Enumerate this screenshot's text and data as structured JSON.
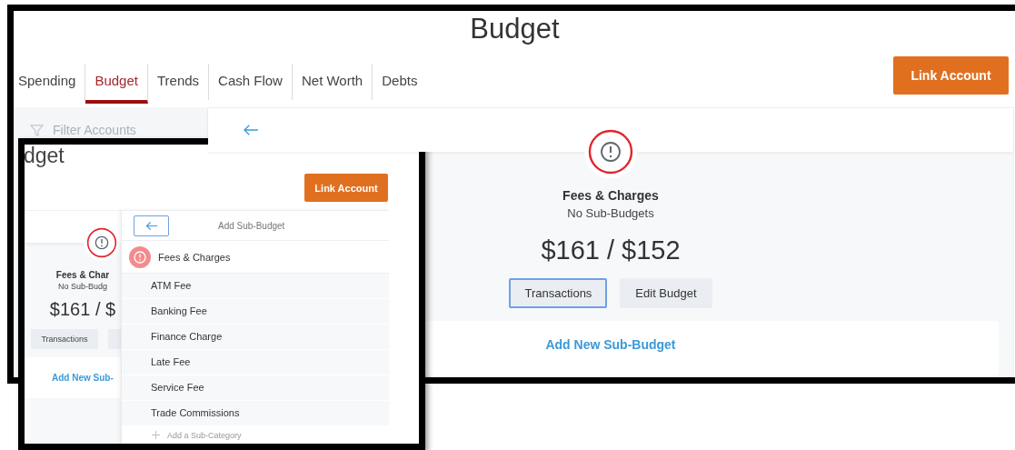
{
  "back_screenshot": {
    "page_title": "Budget",
    "tabs": [
      {
        "label": "Spending",
        "selected": false
      },
      {
        "label": "Budget",
        "selected": true
      },
      {
        "label": "Trends",
        "selected": false
      },
      {
        "label": "Cash Flow",
        "selected": false
      },
      {
        "label": "Net Worth",
        "selected": false
      },
      {
        "label": "Debts",
        "selected": false
      }
    ],
    "link_account_button": "Link Account",
    "filter_field": {
      "placeholder": "Filter Accounts"
    },
    "category": {
      "name": "Fees & Charges",
      "subtitle": "No Sub-Budgets",
      "amount": "$161 / $152"
    },
    "actions": [
      {
        "label": "Transactions",
        "selected": true
      },
      {
        "label": "Edit Budget",
        "selected": false
      }
    ],
    "add_link": "Add New Sub-Budget"
  },
  "front_screenshot": {
    "page_title": "dget",
    "link_account_button": "Link Account",
    "category": {
      "name": "Fees & Char",
      "subtitle": "No Sub-Budg",
      "amount": "$161 / $"
    },
    "actions": [
      {
        "label": "Transactions",
        "selected": false
      }
    ],
    "add_link": "Add New Sub-",
    "sub_budget_panel": {
      "title": "Add Sub-Budget",
      "category": "Fees & Charges",
      "subcategories": [
        "ATM Fee",
        "Banking Fee",
        "Finance Charge",
        "Late Fee",
        "Service Fee",
        "Trade Commissions"
      ],
      "add_action": "Add a Sub-Category"
    }
  }
}
